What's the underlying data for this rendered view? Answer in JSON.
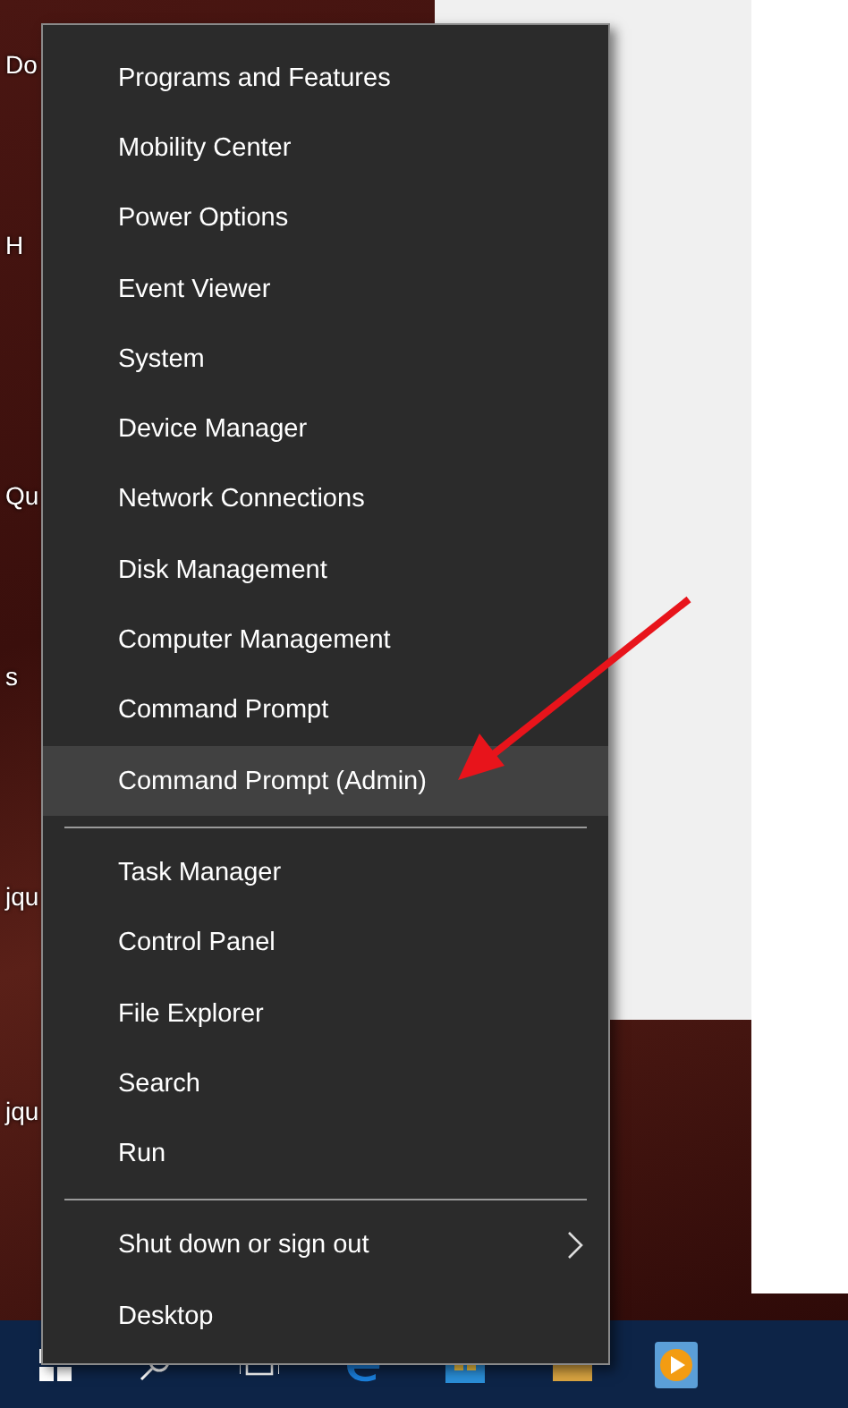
{
  "desktop": {
    "icon_labels": [
      "Do",
      "H",
      "Qu",
      "s",
      "jqu",
      "jqu"
    ]
  },
  "menu": {
    "groups": [
      {
        "items": [
          {
            "label": "Programs and Features",
            "selected": false,
            "submenu": false
          },
          {
            "label": "Mobility Center",
            "selected": false,
            "submenu": false
          },
          {
            "label": "Power Options",
            "selected": false,
            "submenu": false
          },
          {
            "label": "Event Viewer",
            "selected": false,
            "submenu": false
          },
          {
            "label": "System",
            "selected": false,
            "submenu": false
          },
          {
            "label": "Device Manager",
            "selected": false,
            "submenu": false
          },
          {
            "label": "Network Connections",
            "selected": false,
            "submenu": false
          },
          {
            "label": "Disk Management",
            "selected": false,
            "submenu": false
          },
          {
            "label": "Computer Management",
            "selected": false,
            "submenu": false
          },
          {
            "label": "Command Prompt",
            "selected": false,
            "submenu": false
          },
          {
            "label": "Command Prompt (Admin)",
            "selected": true,
            "submenu": false
          }
        ]
      },
      {
        "items": [
          {
            "label": "Task Manager",
            "selected": false,
            "submenu": false
          },
          {
            "label": "Control Panel",
            "selected": false,
            "submenu": false
          },
          {
            "label": "File Explorer",
            "selected": false,
            "submenu": false
          },
          {
            "label": "Search",
            "selected": false,
            "submenu": false
          },
          {
            "label": "Run",
            "selected": false,
            "submenu": false
          }
        ]
      },
      {
        "items": [
          {
            "label": "Shut down or sign out",
            "selected": false,
            "submenu": true
          },
          {
            "label": "Desktop",
            "selected": false,
            "submenu": false
          }
        ]
      }
    ]
  }
}
